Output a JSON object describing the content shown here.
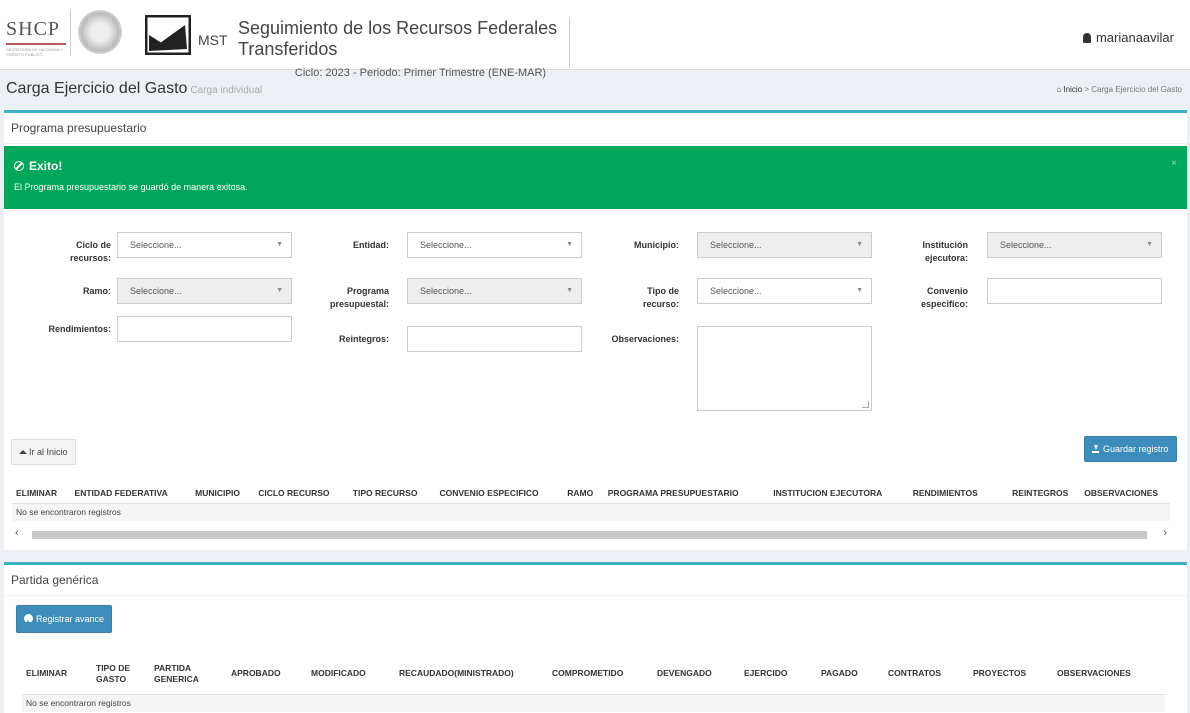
{
  "header": {
    "shcp_logo": "SHCP",
    "shcp_sub": "SECRETARÍA DE HACIENDA Y CRÉDITO PÚBLICO",
    "mst_label": "MST",
    "app_title": "Seguimiento de los Recursos Federales Transferidos",
    "cycle_info": "Ciclo: 2023 - Periodo: Primer Trimestre (ENE-MAR)",
    "username": "marianaavilar"
  },
  "page": {
    "title": "Carga Ejercicio del Gasto",
    "subtitle": "Carga individual",
    "breadcrumb": [
      "Inicio",
      "Carga Ejercicio del Gasto"
    ]
  },
  "programa": {
    "title": "Programa presupuestario",
    "alert_title": "Exito!",
    "alert_message": "El Programa presupuestario se guardó de manera exitosa.",
    "alert_close": "×",
    "labels": {
      "ciclo": "Ciclo de recursos:",
      "entidad": "Entidad:",
      "municipio": "Municipio:",
      "institucion": "Institución ejecutora:",
      "ramo": "Ramo:",
      "programa": "Programa presupuestal:",
      "tipo": "Tipo de recurso:",
      "convenio": "Convenio especifico:",
      "rendimientos": "Rendimientos:",
      "reintegros": "Reintegros:",
      "observaciones": "Observaciones:"
    },
    "select_placeholder": "Seleccione...",
    "btn_home": "Ir al Inicio",
    "btn_save": "Guardar registro",
    "table_headers": [
      "ELIMINAR",
      "ENTIDAD FEDERATIVA",
      "MUNICIPIO",
      "CICLO RECURSO",
      "TIPO RECURSO",
      "CONVENIO ESPECIFICO",
      "RAMO",
      "PROGRAMA PRESUPUESTARIO",
      "INSTITUCION EJECUTORA",
      "RENDIMIENTOS",
      "REINTEGROS",
      "OBSERVACIONES"
    ],
    "empty_text": "No se encontraron registros"
  },
  "partida": {
    "title": "Partida genérica",
    "btn_register": "Registrar avance",
    "table_headers": [
      "ELIMINAR",
      "TIPO DE GASTO",
      "PARTIDA GENERICA",
      "APROBADO",
      "MODIFICADO",
      "RECAUDADO(MINISTRADO)",
      "COMPROMETIDO",
      "DEVENGADO",
      "EJERCIDO",
      "PAGADO",
      "CONTRATOS",
      "PROYECTOS",
      "OBSERVACIONES"
    ],
    "empty_text": "No se encontraron registros"
  },
  "colors": {
    "success": "#00a65a",
    "primary": "#3c8dbc",
    "box_border": "#3cb0c7"
  }
}
